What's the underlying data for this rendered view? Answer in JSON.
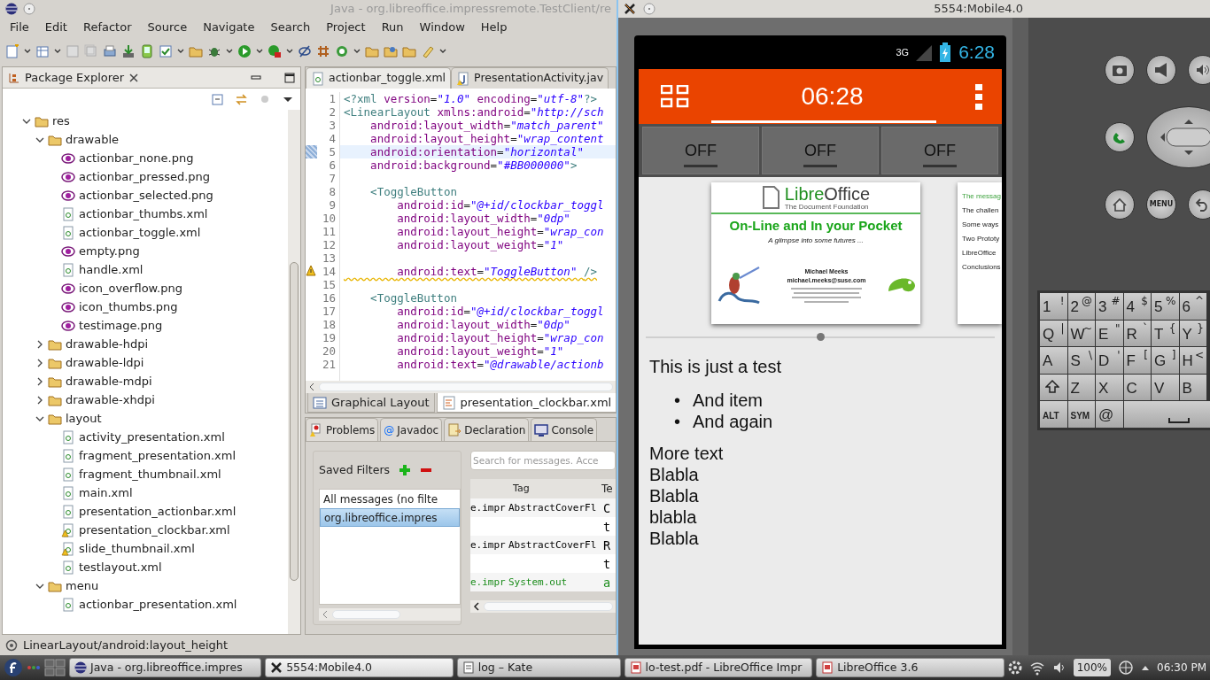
{
  "eclipse": {
    "title": "Java - org.libreoffice.impressremote.TestClient/re",
    "menu": [
      "File",
      "Edit",
      "Refactor",
      "Source",
      "Navigate",
      "Search",
      "Project",
      "Run",
      "Window",
      "Help"
    ],
    "package_explorer": {
      "title": "Package Explorer",
      "tree": [
        {
          "label": "res",
          "kind": "folder",
          "expanded": true,
          "children": [
            {
              "label": "drawable",
              "kind": "folder",
              "expanded": true,
              "children": [
                {
                  "label": "actionbar_none.png",
                  "kind": "image",
                  "warning": false
                },
                {
                  "label": "actionbar_pressed.png",
                  "kind": "image",
                  "warning": false
                },
                {
                  "label": "actionbar_selected.png",
                  "kind": "image",
                  "warning": false
                },
                {
                  "label": "actionbar_thumbs.xml",
                  "kind": "xml",
                  "warning": false
                },
                {
                  "label": "actionbar_toggle.xml",
                  "kind": "xml",
                  "warning": false
                },
                {
                  "label": "empty.png",
                  "kind": "image",
                  "warning": false
                },
                {
                  "label": "handle.xml",
                  "kind": "xml",
                  "warning": false
                },
                {
                  "label": "icon_overflow.png",
                  "kind": "image",
                  "warning": false
                },
                {
                  "label": "icon_thumbs.png",
                  "kind": "image",
                  "warning": false
                },
                {
                  "label": "testimage.png",
                  "kind": "image",
                  "warning": false
                }
              ]
            },
            {
              "label": "drawable-hdpi",
              "kind": "folder",
              "expanded": false
            },
            {
              "label": "drawable-ldpi",
              "kind": "folder",
              "expanded": false
            },
            {
              "label": "drawable-mdpi",
              "kind": "folder",
              "expanded": false
            },
            {
              "label": "drawable-xhdpi",
              "kind": "folder",
              "expanded": false
            },
            {
              "label": "layout",
              "kind": "folder",
              "expanded": true,
              "children": [
                {
                  "label": "activity_presentation.xml",
                  "kind": "xml",
                  "warning": false
                },
                {
                  "label": "fragment_presentation.xml",
                  "kind": "xml",
                  "warning": false
                },
                {
                  "label": "fragment_thumbnail.xml",
                  "kind": "xml",
                  "warning": false
                },
                {
                  "label": "main.xml",
                  "kind": "xml",
                  "warning": false
                },
                {
                  "label": "presentation_actionbar.xml",
                  "kind": "xml",
                  "warning": false
                },
                {
                  "label": "presentation_clockbar.xml",
                  "kind": "xml",
                  "warning": true
                },
                {
                  "label": "slide_thumbnail.xml",
                  "kind": "xml",
                  "warning": true
                },
                {
                  "label": "testlayout.xml",
                  "kind": "xml",
                  "warning": false
                }
              ]
            },
            {
              "label": "menu",
              "kind": "folder",
              "expanded": true,
              "children": [
                {
                  "label": "actionbar_presentation.xml",
                  "kind": "xml",
                  "warning": false
                }
              ]
            }
          ]
        }
      ]
    },
    "editor": {
      "tabs": [
        {
          "label": "actionbar_toggle.xml",
          "kind": "xml",
          "selected": true
        },
        {
          "label": "PresentationActivity.jav",
          "kind": "java",
          "selected": false
        }
      ],
      "lines": [
        {
          "number": "1",
          "text": "<?xml version=\"1.0\" encoding=\"utf-8\"?>",
          "current": false,
          "warning": false
        },
        {
          "number": "2",
          "text": "<LinearLayout xmlns:android=\"http://sch",
          "current": false,
          "warning": false
        },
        {
          "number": "3",
          "text": "    android:layout_width=\"match_parent\"",
          "current": false,
          "warning": false
        },
        {
          "number": "4",
          "text": "    android:layout_height=\"wrap_content",
          "current": false,
          "warning": false
        },
        {
          "number": "5",
          "text": "    android:orientation=\"horizontal\"",
          "current": true,
          "warning": false
        },
        {
          "number": "6",
          "text": "    android:background=\"#BB000000\">",
          "current": false,
          "warning": false
        },
        {
          "number": "7",
          "current": false,
          "warning": false
        },
        {
          "number": "8",
          "text": "    <ToggleButton",
          "current": false,
          "warning": false
        },
        {
          "number": "9",
          "text": "        android:id=\"@+id/clockbar_toggl",
          "current": false,
          "warning": false
        },
        {
          "number": "10",
          "text": "        android:layout_width=\"0dp\"",
          "current": false,
          "warning": false
        },
        {
          "number": "11",
          "text": "        android:layout_height=\"wrap_con",
          "current": false,
          "warning": false
        },
        {
          "number": "12",
          "text": "        android:layout_weight=\"1\"",
          "current": false,
          "warning": false
        },
        {
          "number": "13",
          "current": false,
          "warning": false
        },
        {
          "number": "14",
          "text": "        android:text=\"ToggleButton\" />",
          "current": false,
          "warning": true
        },
        {
          "number": "15",
          "current": false,
          "warning": false
        },
        {
          "number": "16",
          "text": "    <ToggleButton",
          "current": false,
          "warning": false
        },
        {
          "number": "17",
          "text": "        android:id=\"@+id/clockbar_toggl",
          "current": false,
          "warning": false
        },
        {
          "number": "18",
          "text": "        android:layout_width=\"0dp\"",
          "current": false,
          "warning": false
        },
        {
          "number": "19",
          "text": "        android:layout_height=\"wrap_con",
          "current": false,
          "warning": false
        },
        {
          "number": "20",
          "text": "        android:layout_weight=\"1\"",
          "current": false,
          "warning": false
        },
        {
          "number": "21",
          "text": "        android:text=\"@drawable/actionb",
          "current": false,
          "warning": false
        }
      ],
      "bottom_tabs": [
        {
          "label": "Graphical Layout",
          "selected": false
        },
        {
          "label": "presentation_clockbar.xml",
          "selected": true
        }
      ]
    },
    "logcat": {
      "tabs": [
        {
          "label": "Problems",
          "kind": "problems"
        },
        {
          "label": "Javadoc",
          "kind": "at",
          "glyph": "@"
        },
        {
          "label": "Declaration",
          "kind": "declaration"
        },
        {
          "label": "Console",
          "kind": "console"
        }
      ],
      "saved_filters_label": "Saved Filters",
      "filters": [
        {
          "label": "All messages (no filte",
          "selected": false
        },
        {
          "label": "org.libreoffice.impres",
          "selected": true
        }
      ],
      "search": {
        "placeholder": "Search for messages. Acce"
      },
      "columns": [
        null,
        "Tag",
        "Te"
      ],
      "rows": [
        {
          "cells": [
            "e.impr",
            "AbstractCoverFl",
            "C"
          ],
          "color": "#000000"
        },
        {
          "cells": [
            null,
            null,
            "t"
          ],
          "color": "#000000"
        },
        {
          "cells": [
            "e.impr",
            "AbstractCoverFl",
            "R"
          ],
          "color": "#000000"
        },
        {
          "cells": [
            null,
            null,
            "t"
          ],
          "color": "#000000"
        },
        {
          "cells": [
            "e.impr",
            "System.out",
            "a"
          ],
          "color": "#1a8c1a"
        }
      ]
    },
    "status_bar": "LinearLayout/android:layout_height"
  },
  "emulator": {
    "title": "5554:Mobile4.0",
    "status": {
      "network": "3G",
      "time": "6:28"
    },
    "action_bar": {
      "clock": "06:28"
    },
    "toggles": [
      {
        "label": "OFF",
        "on": false
      },
      {
        "label": "OFF",
        "on": false
      },
      {
        "label": "OFF",
        "on": false
      }
    ],
    "slide": {
      "logo_first": "Libre",
      "logo_second": "Office",
      "logo_subtitle": "The Document Foundation",
      "title": "On-Line and In your Pocket",
      "subtitle": "A glimpse into some futures ...",
      "author": "Michael Meeks",
      "email": "michael.meeks@suse.com"
    },
    "next_slide": {
      "title": "The messag",
      "items": [
        "The challen",
        "Some ways",
        "Two Prototy",
        "LibreOffice",
        "Conclusions"
      ]
    },
    "content": {
      "heading": "This is just a test",
      "bullets": [
        {
          "marker": "•",
          "text": "And item"
        },
        {
          "marker": "•",
          "text": "And again"
        }
      ],
      "lines": [
        "More text",
        "Blabla",
        "Blabla",
        "blabla",
        "Blabla"
      ]
    },
    "menu_key": "MENU",
    "keyboard": [
      [
        {
          "main": "1",
          "alt": "!"
        },
        {
          "main": "2",
          "alt": "@"
        },
        {
          "main": "3",
          "alt": "#"
        },
        {
          "main": "4",
          "alt": "$"
        },
        {
          "main": "5",
          "alt": "%"
        },
        {
          "main": "6",
          "alt": "^"
        }
      ],
      [
        {
          "main": "Q",
          "alt": "|"
        },
        {
          "main": "W",
          "alt": "~"
        },
        {
          "main": "E",
          "alt": "\""
        },
        {
          "main": "R",
          "alt": "`"
        },
        {
          "main": "T",
          "alt": "{"
        },
        {
          "main": "Y",
          "alt": "}"
        }
      ],
      [
        {
          "main": "A"
        },
        {
          "main": "S",
          "alt": "\\"
        },
        {
          "main": "D",
          "alt": "'"
        },
        {
          "main": "F",
          "alt": "["
        },
        {
          "main": "G",
          "alt": "]"
        },
        {
          "main": "H",
          "alt": "<"
        }
      ],
      [
        {
          "kind": "shift"
        },
        {
          "main": "Z"
        },
        {
          "main": "X"
        },
        {
          "main": "C"
        },
        {
          "main": "V"
        },
        {
          "main": "B"
        }
      ],
      [
        {
          "main": "ALT",
          "kind": "small"
        },
        {
          "main": "SYM",
          "kind": "small"
        },
        {
          "main": "@"
        },
        {
          "kind": "space"
        }
      ]
    ]
  },
  "taskbar": {
    "tasks": [
      {
        "label": "Java - org.libreoffice.impres",
        "kind": "eclipse",
        "selected": false
      },
      {
        "label": "5554:Mobile4.0",
        "kind": "x",
        "selected": true
      },
      {
        "label": "log – Kate",
        "kind": "editor",
        "selected": false
      },
      {
        "label": "lo-test.pdf - LibreOffice Impr",
        "kind": "impress",
        "selected": false
      },
      {
        "label": "LibreOffice 3.6",
        "kind": "impress",
        "selected": false
      }
    ],
    "battery": "100%",
    "clock": "06:30 PM"
  }
}
